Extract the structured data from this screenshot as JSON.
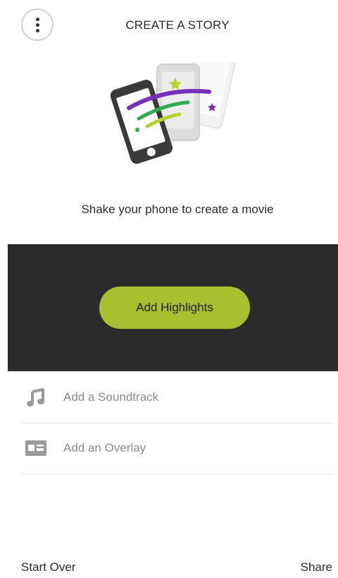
{
  "header": {
    "title": "CREATE A STORY",
    "menu_icon": "more-vertical-icon"
  },
  "hero": {
    "illustration": "shake-phone-illustration",
    "instruction": "Shake your phone to create a movie"
  },
  "highlights": {
    "button_label": "Add Highlights"
  },
  "options": [
    {
      "label": "Add a Soundtrack",
      "icon": "music-note-icon"
    },
    {
      "label": "Add an Overlay",
      "icon": "overlay-icon"
    }
  ],
  "footer": {
    "left_label": "Start Over",
    "right_label": "Share"
  },
  "colors": {
    "accent": "#a8bf2f",
    "panel": "#2b2b2b",
    "purple": "#7a2fb8",
    "green": "#2eaa4f"
  }
}
